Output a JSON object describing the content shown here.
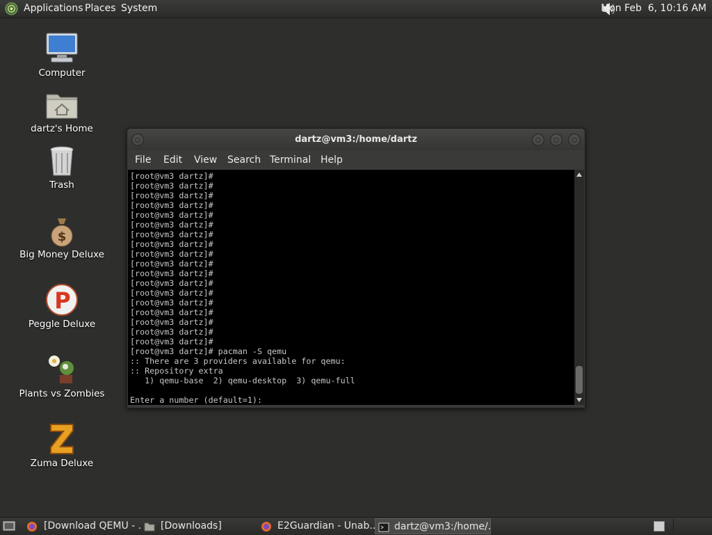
{
  "top_panel": {
    "menus": [
      "Applications",
      "Places",
      "System"
    ],
    "clock": "Mon Feb  6, 10:16 AM",
    "logo_icon": "gnome-foot-icon",
    "volume_icon": "speaker-icon"
  },
  "desktop": {
    "icons": [
      {
        "label": "Computer",
        "icon": "computer-monitor-icon"
      },
      {
        "label": "dartz's Home",
        "icon": "home-folder-icon"
      },
      {
        "label": "Trash",
        "icon": "trash-can-icon"
      },
      {
        "label": "Big Money Deluxe",
        "icon": "money-bag-icon"
      },
      {
        "label": "Peggle Deluxe",
        "icon": "peggle-ball-icon"
      },
      {
        "label": "Plants vs Zombies",
        "icon": "flower-zombie-icon"
      },
      {
        "label": "Zuma Deluxe",
        "icon": "zuma-z-icon"
      }
    ]
  },
  "terminal": {
    "title": "dartz@vm3:/home/dartz",
    "menu": [
      "File",
      "Edit",
      "View",
      "Search",
      "Terminal",
      "Help"
    ],
    "lines": [
      "[root@vm3 dartz]#",
      "[root@vm3 dartz]#",
      "[root@vm3 dartz]#",
      "[root@vm3 dartz]#",
      "[root@vm3 dartz]#",
      "[root@vm3 dartz]#",
      "[root@vm3 dartz]#",
      "[root@vm3 dartz]#",
      "[root@vm3 dartz]#",
      "[root@vm3 dartz]#",
      "[root@vm3 dartz]#",
      "[root@vm3 dartz]#",
      "[root@vm3 dartz]#",
      "[root@vm3 dartz]#",
      "[root@vm3 dartz]#",
      "[root@vm3 dartz]#",
      "[root@vm3 dartz]#",
      "[root@vm3 dartz]#",
      "[root@vm3 dartz]# pacman -S qemu",
      ":: There are 3 providers available for qemu:",
      ":: Repository extra",
      "   1) qemu-base  2) qemu-desktop  3) qemu-full",
      "",
      "Enter a number (default=1):"
    ]
  },
  "taskbar": {
    "tasks": [
      {
        "label": "[Download QEMU - ...",
        "icon": "firefox-icon",
        "active": false
      },
      {
        "label": "[Downloads]",
        "icon": "folder-icon",
        "active": false
      },
      {
        "label": "E2Guardian - Unab...",
        "icon": "firefox-icon",
        "active": false
      },
      {
        "label": "dartz@vm3:/home/...",
        "icon": "terminal-icon",
        "active": true
      }
    ],
    "show_desktop_icon": "show-desktop-icon",
    "workspace_icon": "workspace-switcher-icon"
  },
  "colors": {
    "desktop_bg": "#2e2f2d",
    "terminal_bg": "#000000",
    "terminal_fg": "#c7c7c7"
  }
}
